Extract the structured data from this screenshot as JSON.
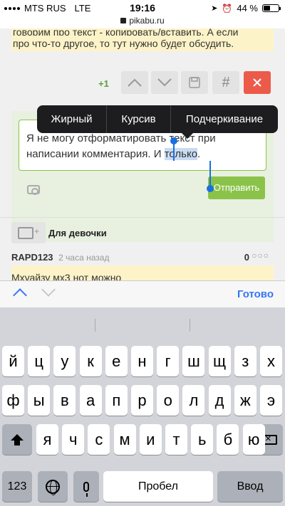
{
  "status_bar": {
    "carrier": "MTS RUS",
    "network": "LTE",
    "time": "19:16",
    "battery": "44 %",
    "battery_level": 0.44
  },
  "url_bar": {
    "domain": "pikabu.ru"
  },
  "post": {
    "quote_line1": "говорим про текст - копировать/вставить. А если",
    "quote_line2": "про что-то другое, то тут нужно будет обсудить."
  },
  "toolbar": {
    "vote_count": "+1",
    "hash_label": "#"
  },
  "editor": {
    "text_line1": "Я не могу отформатировать текст при",
    "text_line2_before": "написании комментария. И ",
    "text_line2_selected": "только",
    "text_line2_after": ".",
    "send_label": "Отправить"
  },
  "context_menu": {
    "items": [
      "Жирный",
      "Курсив",
      "Подчеркивание"
    ]
  },
  "reply": {
    "label": "Для девочки"
  },
  "comment": {
    "author": "RAPD123",
    "time": "2 часа назад",
    "score": "0",
    "more": "○○○",
    "text": "Мхуайзу мх3 нот можно"
  },
  "accessory": {
    "done_label": "Готово"
  },
  "keyboard": {
    "row1": [
      "й",
      "ц",
      "у",
      "к",
      "е",
      "н",
      "г",
      "ш",
      "щ",
      "з",
      "х"
    ],
    "row2": [
      "ф",
      "ы",
      "в",
      "а",
      "п",
      "р",
      "о",
      "л",
      "д",
      "ж",
      "э"
    ],
    "row3": [
      "я",
      "ч",
      "с",
      "м",
      "и",
      "т",
      "ь",
      "б",
      "ю"
    ],
    "numbers_label": "123",
    "space_label": "Пробел",
    "return_label": "Ввод"
  },
  "colors": {
    "accent_green": "#8bc34a",
    "close_red": "#ec5b49",
    "ios_blue": "#3478f6",
    "selection": "#c9dbf2"
  },
  "icons": [
    "arrow-up-icon",
    "arrow-down-icon",
    "save-icon",
    "hash-icon",
    "close-icon",
    "camera-icon",
    "comment-icon",
    "shift-icon",
    "backspace-icon",
    "globe-icon",
    "mic-icon",
    "location-icon",
    "alarm-icon",
    "lock-icon"
  ]
}
